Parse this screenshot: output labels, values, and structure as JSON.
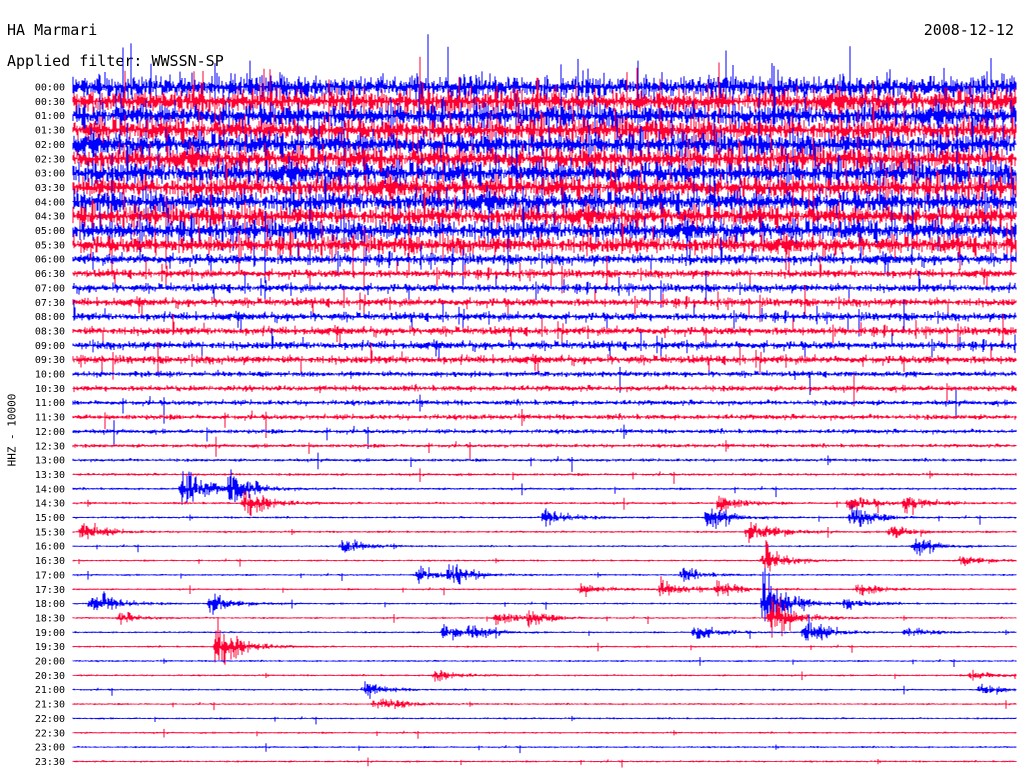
{
  "header": {
    "station": "HA Marmari",
    "date": "2008-12-12",
    "filter": "Applied filter: WWSSN-SP"
  },
  "chart_data": {
    "type": "line",
    "title": "HA Marmari",
    "date": "2008-12-12",
    "ylabel": "HHZ - 10000",
    "trace_colors": [
      "#0000ff",
      "#ff0033"
    ],
    "rows": [
      "00:00",
      "00:30",
      "01:00",
      "01:30",
      "02:00",
      "02:30",
      "03:00",
      "03:30",
      "04:00",
      "04:30",
      "05:00",
      "05:30",
      "06:00",
      "06:30",
      "07:00",
      "07:30",
      "08:00",
      "08:30",
      "09:00",
      "09:30",
      "10:00",
      "10:30",
      "11:00",
      "11:30",
      "12:00",
      "12:30",
      "13:00",
      "13:30",
      "14:00",
      "14:30",
      "15:00",
      "15:30",
      "16:00",
      "16:30",
      "17:00",
      "17:30",
      "18:00",
      "18:30",
      "19:00",
      "19:30",
      "20:00",
      "20:30",
      "21:00",
      "21:30",
      "22:00",
      "22:30",
      "23:00",
      "23:30"
    ],
    "noise_levels": [
      9,
      9,
      9,
      9,
      9,
      9,
      9,
      8.5,
      8.5,
      8,
      8,
      7,
      4,
      3,
      3,
      3,
      3,
      3,
      3,
      3,
      2,
      2,
      1.8,
      1.8,
      1.5,
      1.2,
      1,
      0.8,
      0.7,
      0.7,
      0.6,
      0.6,
      0.5,
      0.5,
      0.5,
      0.5,
      0.5,
      0.5,
      0.5,
      0.5,
      0.5,
      0.5,
      0.5,
      0.5,
      0.5,
      0.5,
      0.5,
      0.5
    ],
    "events": [
      {
        "row": 33,
        "minute": 22.0,
        "amp": 14
      },
      {
        "row": 34,
        "minute": 12.0,
        "amp": 12
      },
      {
        "row": 28,
        "minute": 3.5,
        "amp": 22
      },
      {
        "row": 28,
        "minute": 5.0,
        "amp": 18
      },
      {
        "row": 29,
        "minute": 5.5,
        "amp": 16
      },
      {
        "row": 30,
        "minute": 15.0,
        "amp": 10
      },
      {
        "row": 31,
        "minute": 0.3,
        "amp": 10
      },
      {
        "row": 36,
        "minute": 0.6,
        "amp": 10
      },
      {
        "row": 36,
        "minute": 1.0,
        "amp": 9
      },
      {
        "row": 36,
        "minute": 4.4,
        "amp": 10
      },
      {
        "row": 37,
        "minute": 14.5,
        "amp": 8
      },
      {
        "row": 38,
        "minute": 19.8,
        "amp": 8
      },
      {
        "row": 39,
        "minute": 4.6,
        "amp": 26
      },
      {
        "row": 38,
        "minute": 11.8,
        "amp": 8
      },
      {
        "row": 35,
        "minute": 20.5,
        "amp": 8
      },
      {
        "row": 31,
        "minute": 22.0,
        "amp": 8
      },
      {
        "row": 29,
        "minute": 26.5,
        "amp": 9
      },
      {
        "row": 29,
        "minute": 20.6,
        "amp": 8
      },
      {
        "row": 30,
        "minute": 20.2,
        "amp": 10
      },
      {
        "row": 29,
        "minute": 24.7,
        "amp": 8
      },
      {
        "row": 34,
        "minute": 11.0,
        "amp": 7
      },
      {
        "row": 32,
        "minute": 26.8,
        "amp": 7
      },
      {
        "row": 35,
        "minute": 25.0,
        "amp": 7
      },
      {
        "row": 33,
        "minute": 28.3,
        "amp": 6
      },
      {
        "row": 31,
        "minute": 21.5,
        "amp": 9
      },
      {
        "row": 30,
        "minute": 24.8,
        "amp": 12
      },
      {
        "row": 35,
        "minute": 16.2,
        "amp": 6
      },
      {
        "row": 37,
        "minute": 13.5,
        "amp": 7
      },
      {
        "row": 38,
        "minute": 12.6,
        "amp": 7
      },
      {
        "row": 31,
        "minute": 26.0,
        "amp": 6
      },
      {
        "row": 34,
        "minute": 19.4,
        "amp": 6
      },
      {
        "row": 32,
        "minute": 8.6,
        "amp": 7
      },
      {
        "row": 37,
        "minute": 1.5,
        "amp": 5
      },
      {
        "row": 37,
        "minute": 23.0,
        "amp": 5
      },
      {
        "row": 41,
        "minute": 11.5,
        "amp": 6
      },
      {
        "row": 42,
        "minute": 9.3,
        "amp": 6
      },
      {
        "row": 43,
        "minute": 9.6,
        "amp": 5
      },
      {
        "row": 35,
        "minute": 18.7,
        "amp": 8
      },
      {
        "row": 36,
        "minute": 24.6,
        "amp": 6
      },
      {
        "row": 36,
        "minute": 22.0,
        "amp": 30
      },
      {
        "row": 37,
        "minute": 22.2,
        "amp": 24
      },
      {
        "row": 38,
        "minute": 23.3,
        "amp": 14
      },
      {
        "row": 41,
        "minute": 28.6,
        "amp": 5
      },
      {
        "row": 42,
        "minute": 28.9,
        "amp": 5
      },
      {
        "row": 43,
        "minute": 10.0,
        "amp": 5
      },
      {
        "row": 38,
        "minute": 26.5,
        "amp": 5
      }
    ]
  }
}
